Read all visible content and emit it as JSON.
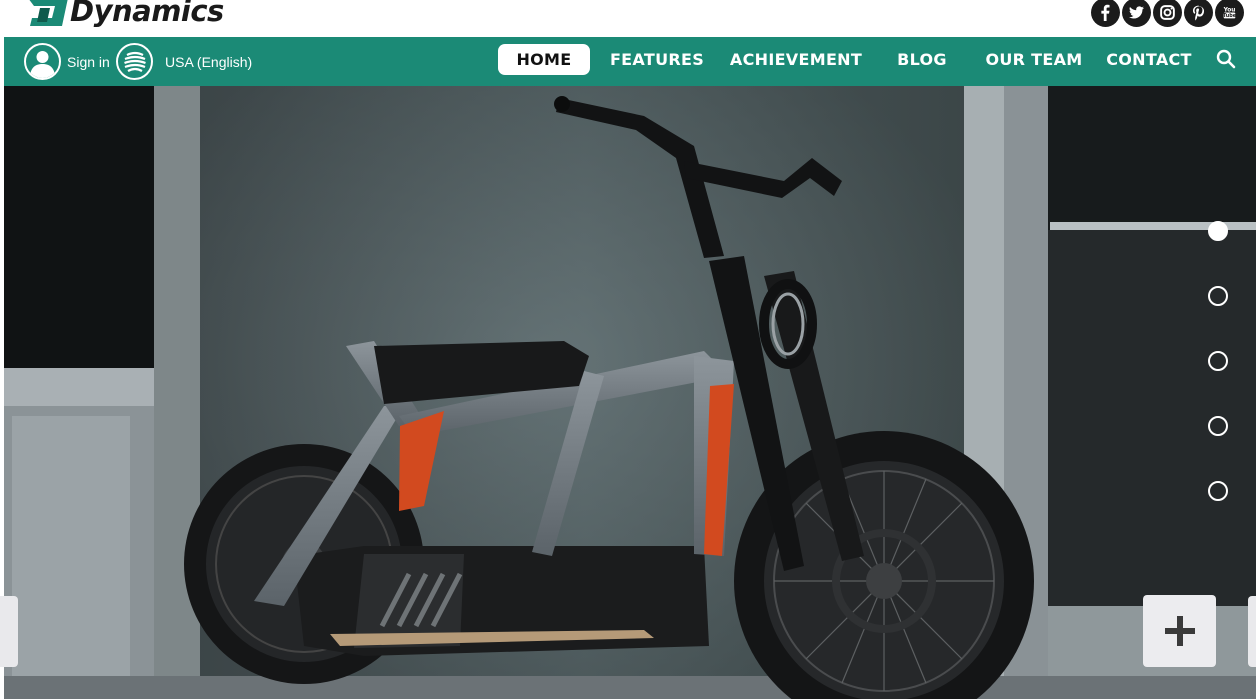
{
  "brand": {
    "logo_text": "Dynamics",
    "accent_color": "#1b8a76"
  },
  "socials": [
    {
      "name": "facebook",
      "glyph": "f"
    },
    {
      "name": "twitter",
      "glyph": "t"
    },
    {
      "name": "instagram",
      "glyph": "i"
    },
    {
      "name": "pinterest",
      "glyph": "P"
    },
    {
      "name": "youtube",
      "glyph": "You\nTube"
    }
  ],
  "header": {
    "sign_in_label": "Sign in",
    "region_label": "USA (English)"
  },
  "nav": {
    "items": [
      {
        "label": "HOME",
        "active": true
      },
      {
        "label": "FEATURES",
        "active": false
      },
      {
        "label": "ACHIEVEMENT",
        "active": false
      },
      {
        "label": "BLOG",
        "active": false
      },
      {
        "label": "OUR TEAM",
        "active": false
      },
      {
        "label": "CONTACT",
        "active": false
      }
    ]
  },
  "slider": {
    "slide_count": 5,
    "active_index": 0,
    "image_subject": "electric motorbike"
  },
  "actions": {
    "expand_icon": "plus-icon"
  }
}
